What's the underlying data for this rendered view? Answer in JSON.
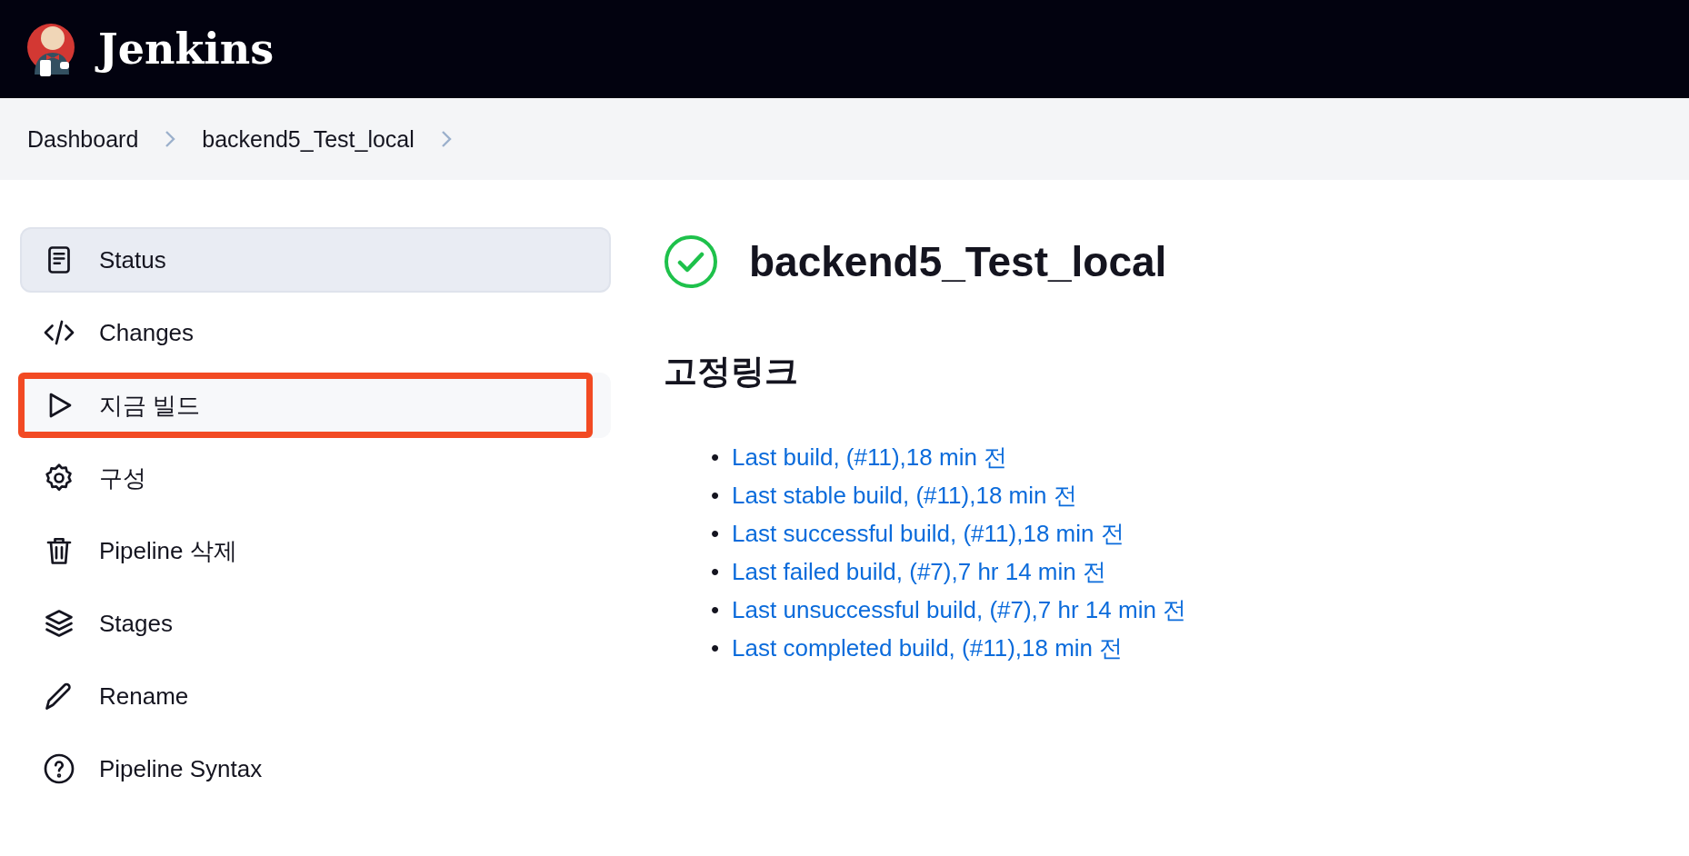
{
  "header": {
    "title": "Jenkins"
  },
  "breadcrumbs": [
    {
      "label": "Dashboard"
    },
    {
      "label": "backend5_Test_local"
    }
  ],
  "sidebar": {
    "items": [
      {
        "label": "Status",
        "selected": true,
        "annotated": false
      },
      {
        "label": "Changes",
        "selected": false,
        "annotated": false
      },
      {
        "label": "지금 빌드",
        "selected": false,
        "annotated": true
      },
      {
        "label": "구성",
        "selected": false,
        "annotated": false
      },
      {
        "label": "Pipeline 삭제",
        "selected": false,
        "annotated": false
      },
      {
        "label": "Stages",
        "selected": false,
        "annotated": false
      },
      {
        "label": "Rename",
        "selected": false,
        "annotated": false
      },
      {
        "label": "Pipeline Syntax",
        "selected": false,
        "annotated": false
      }
    ]
  },
  "job": {
    "title": "backend5_Test_local"
  },
  "permalinks": {
    "heading": "고정링크",
    "links": [
      {
        "bullet": "•",
        "label": "Last build, (#11),18 min 전"
      },
      {
        "bullet": "•",
        "label": "Last stable build, (#11),18 min 전"
      },
      {
        "bullet": "•",
        "label": "Last successful build, (#11),18 min 전"
      },
      {
        "bullet": "•",
        "label": "Last failed build, (#7),7 hr 14 min 전"
      },
      {
        "bullet": "•",
        "label": "Last unsuccessful build, (#7),7 hr 14 min 전"
      },
      {
        "bullet": "•",
        "label": "Last completed build, (#11),18 min 전"
      }
    ]
  }
}
